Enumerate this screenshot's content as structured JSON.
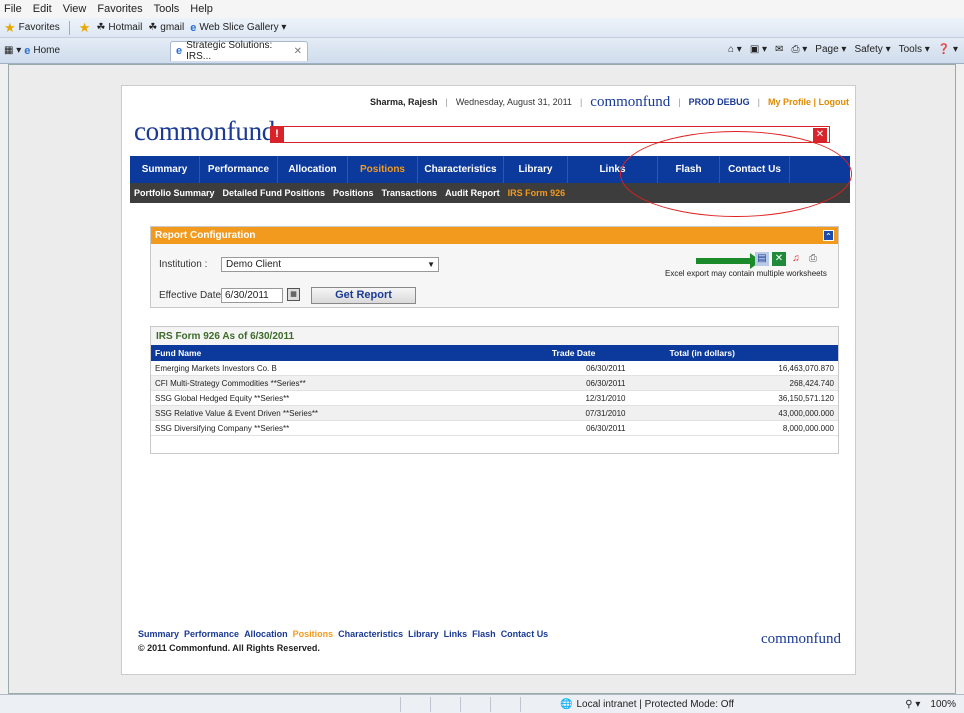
{
  "browser": {
    "menu": [
      "File",
      "Edit",
      "View",
      "Favorites",
      "Tools",
      "Help"
    ],
    "favorites_label": "Favorites",
    "favorites_links": [
      "Hotmail",
      "gmail",
      "Web Slice Gallery ▾"
    ],
    "home_tab": "Home",
    "active_tab": "Strategic Solutions: IRS...",
    "tab_close": "✕",
    "commands": [
      "⌂ ▾",
      "▣ ▾",
      "✉",
      "⎙ ▾",
      "Page ▾",
      "Safety ▾",
      "Tools ▾",
      "❓ ▾"
    ],
    "status_zone": "Local intranet | Protected Mode: Off",
    "zoom": "100%",
    "zoom_icon": "⚲ ▾"
  },
  "header": {
    "user": "Sharma, Rajesh",
    "date": "Wednesday, August 31, 2011",
    "logo_small": "commonfund",
    "prod_debug": "PROD DEBUG",
    "profile": "My Profile | Logout",
    "logo": "commonfund",
    "alert_bang": "!",
    "alert_close": "✕"
  },
  "main_nav": [
    {
      "label": "Summary",
      "w": 70
    },
    {
      "label": "Performance",
      "w": 78
    },
    {
      "label": "Allocation",
      "w": 70
    },
    {
      "label": "Positions",
      "w": 70,
      "active": true
    },
    {
      "label": "Characteristics",
      "w": 86
    },
    {
      "label": "Library",
      "w": 64
    },
    {
      "label": "Links",
      "w": 90
    },
    {
      "label": "Flash",
      "w": 62
    },
    {
      "label": "Contact Us",
      "w": 70
    }
  ],
  "sub_nav": [
    {
      "label": "Portfolio Summary"
    },
    {
      "label": "Detailed Fund Positions"
    },
    {
      "label": "Positions"
    },
    {
      "label": "Transactions"
    },
    {
      "label": "Audit Report"
    },
    {
      "label": "IRS Form 926",
      "active": true
    }
  ],
  "config": {
    "title": "Report Configuration",
    "collapse": "⌃",
    "institution_label": "Institution :",
    "institution_value": "Demo Client",
    "date_label": "Effective Date:",
    "date_value": "6/30/2011",
    "get_report": "Get Report",
    "export_note": "Excel export may contain multiple worksheets",
    "export_icons": [
      "html-export-icon",
      "excel-icon",
      "pdf-icon",
      "print-icon"
    ]
  },
  "report": {
    "title": "IRS Form 926 As of 6/30/2011",
    "columns": [
      "Fund Name",
      "Trade Date",
      "Total (in dollars)"
    ],
    "rows": [
      [
        "Emerging Markets Investors Co. B",
        "06/30/2011",
        "16,463,070.870"
      ],
      [
        "CFI Multi-Strategy Commodities **Series**",
        "06/30/2011",
        "268,424.740"
      ],
      [
        "SSG Global Hedged Equity **Series**",
        "12/31/2010",
        "36,150,571.120"
      ],
      [
        "SSG Relative Value & Event Driven **Series**",
        "07/31/2010",
        "43,000,000.000"
      ],
      [
        "SSG Diversifying Company **Series**",
        "06/30/2011",
        "8,000,000.000"
      ]
    ]
  },
  "footer": {
    "links": [
      {
        "label": "Summary"
      },
      {
        "label": "Performance"
      },
      {
        "label": "Allocation"
      },
      {
        "label": "Positions",
        "active": true
      },
      {
        "label": "Characteristics"
      },
      {
        "label": "Library"
      },
      {
        "label": "Links"
      },
      {
        "label": "Flash"
      },
      {
        "label": "Contact Us"
      }
    ],
    "copyright": "© 2011 Commonfund. All Rights Reserved.",
    "logo": "commonfund"
  },
  "colors": {
    "nav_blue": "#0c3a9c",
    "accent_orange": "#f29a1e",
    "alert_red": "#d8232a"
  }
}
